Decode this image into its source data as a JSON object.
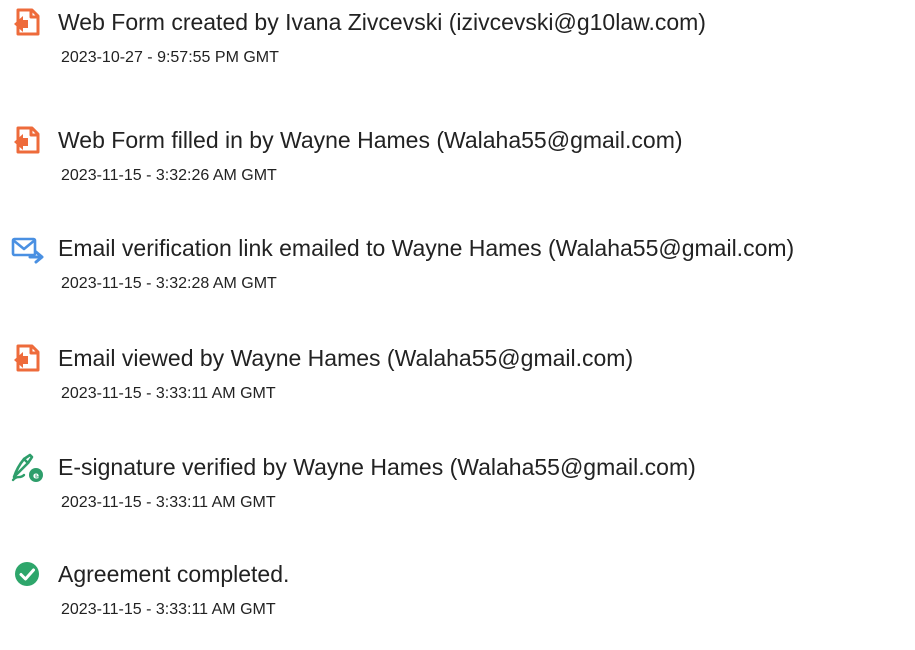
{
  "events": [
    {
      "icon": "document-icon",
      "text": "Web Form created by Ivana Zivcevski (izivcevski@g10law.com)",
      "time": "2023-10-27 - 9:57:55 PM GMT"
    },
    {
      "icon": "document-icon",
      "text": "Web Form filled in by Wayne Hames (Walaha55@gmail.com)",
      "time": "2023-11-15 - 3:32:26 AM GMT"
    },
    {
      "icon": "email-send-icon",
      "text": "Email verification link emailed to Wayne Hames (Walaha55@gmail.com)",
      "time": "2023-11-15 - 3:32:28 AM GMT"
    },
    {
      "icon": "document-icon",
      "text": "Email viewed by Wayne Hames (Walaha55@gmail.com)",
      "time": "2023-11-15 - 3:33:11 AM GMT"
    },
    {
      "icon": "e-signature-icon",
      "text": "E-signature verified by Wayne Hames (Walaha55@gmail.com)",
      "time": "2023-11-15 - 3:33:11 AM GMT"
    },
    {
      "icon": "check-circle-icon",
      "text": "Agreement completed.",
      "time": "2023-11-15 - 3:33:11 AM GMT"
    }
  ],
  "colors": {
    "document_icon": "#EE6B3B",
    "email_icon": "#4A90E2",
    "signature_icon": "#2E9E6B",
    "check_icon": "#2EA66B",
    "text": "#222222"
  }
}
